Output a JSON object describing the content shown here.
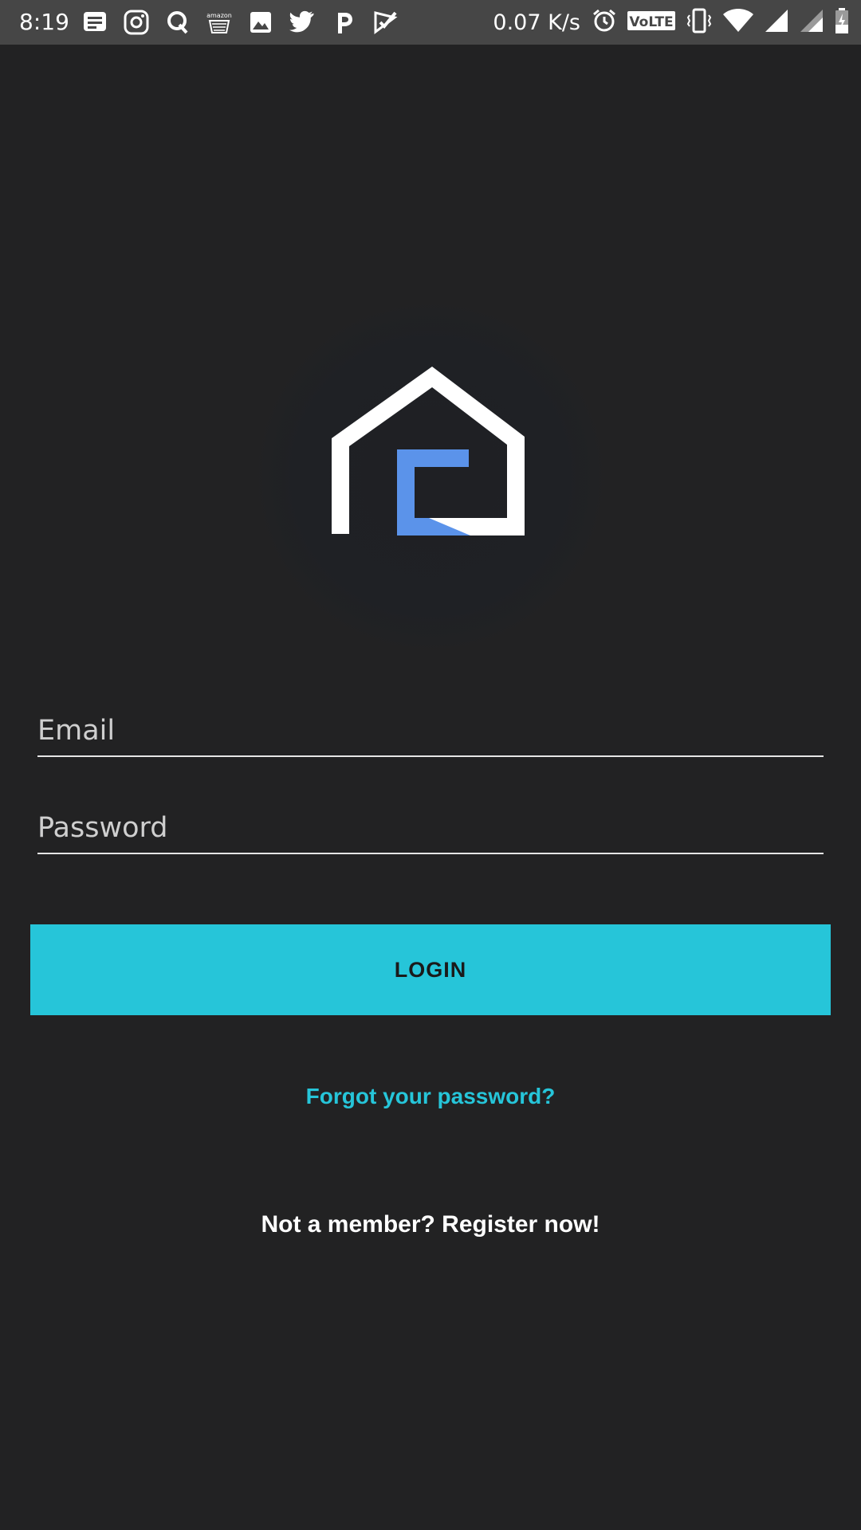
{
  "status_bar": {
    "time": "8:19",
    "net_speed": "0.07 K/s",
    "volte_label": "VoLTE",
    "amazon_label": "amazon",
    "left_icons": [
      "messages-icon",
      "instagram-icon",
      "quora-icon",
      "amazon-icon",
      "gallery-icon",
      "twitter-icon",
      "paytm-icon",
      "tasks-icon"
    ],
    "right_icons": [
      "alarm-icon",
      "volte-icon",
      "vibrate-icon",
      "wifi-icon",
      "signal-icon",
      "signal-icon-2",
      "battery-charging-icon"
    ]
  },
  "logo": {
    "name": "house-logo-icon",
    "colors": {
      "house": "#ffffff",
      "accent": "#5b93ea"
    }
  },
  "form": {
    "email_placeholder": "Email",
    "email_value": "",
    "password_placeholder": "Password",
    "password_value": ""
  },
  "actions": {
    "login_label": "LOGIN",
    "forgot_label": "Forgot your password?",
    "register_label": "Not a member? Register now!"
  },
  "colors": {
    "background": "#222223",
    "status_bar": "#464646",
    "accent": "#26c5d9"
  }
}
